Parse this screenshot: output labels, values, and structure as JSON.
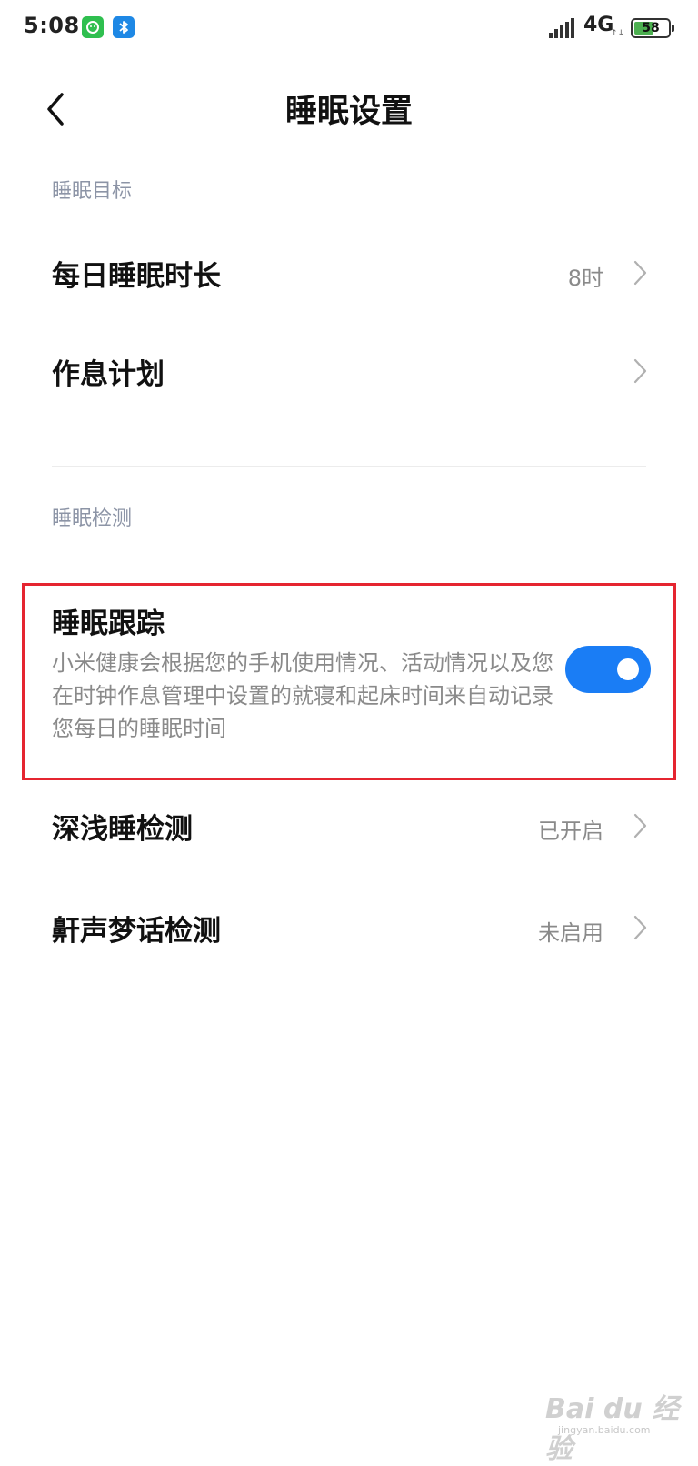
{
  "status_bar": {
    "time": "5:08",
    "network": "4G",
    "battery": "58",
    "battery_level": 0.58
  },
  "header": {
    "title": "睡眠设置"
  },
  "sections": {
    "goal": {
      "header": "睡眠目标",
      "daily_duration_label": "每日睡眠时长",
      "daily_duration_value": "8时",
      "schedule_label": "作息计划"
    },
    "detection": {
      "header": "睡眠检测",
      "tracking": {
        "title": "睡眠跟踪",
        "description": "小米健康会根据您的手机使用情况、活动情况以及您在时钟作息管理中设置的就寝和起床时间来自动记录您每日的睡眠时间",
        "enabled": true
      },
      "deep_light_label": "深浅睡检测",
      "deep_light_value": "已开启",
      "snore_label": "鼾声梦话检测",
      "snore_value": "未启用"
    }
  },
  "watermark": {
    "main": "Bai du 经验",
    "sub": "jingyan.baidu.com"
  },
  "colors": {
    "accent": "#1a7df5",
    "highlight": "#e52530",
    "section_header": "#8c94a6",
    "secondary_text": "#8a8a8a"
  }
}
